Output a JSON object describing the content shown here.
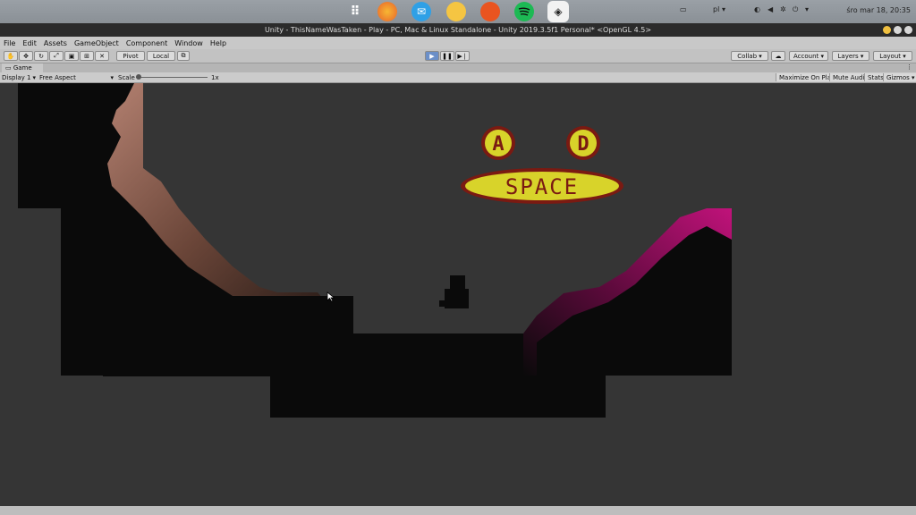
{
  "desktop": {
    "apps": [
      {
        "name": "apps-grid-icon",
        "glyph": "⋮⋮⋮",
        "color": "#8a9096"
      },
      {
        "name": "firefox-icon",
        "glyph": "",
        "color": "#e8632a"
      },
      {
        "name": "mail-icon",
        "glyph": "✉",
        "color": "#2fa0e6"
      },
      {
        "name": "files-icon",
        "glyph": "",
        "color": "#f5c542"
      },
      {
        "name": "software-icon",
        "glyph": "",
        "color": "#e95420"
      },
      {
        "name": "spotify-icon",
        "glyph": "",
        "color": "#1db954"
      },
      {
        "name": "unity-icon",
        "glyph": "◈",
        "color": "#f2f2f2"
      }
    ],
    "language": "pl",
    "clock": "śro mar 18, 20:35"
  },
  "window": {
    "title": "Unity - ThisNameWasTaken - Play - PC, Mac & Linux Standalone - Unity 2019.3.5f1 Personal* <OpenGL 4.5>"
  },
  "menu": [
    "File",
    "Edit",
    "Assets",
    "GameObject",
    "Component",
    "Window",
    "Help"
  ],
  "toolbar": {
    "pivot": "Pivot",
    "local": "Local",
    "collab": "Collab ▾",
    "account": "Account",
    "layers": "Layers",
    "layout": "Layout"
  },
  "game_panel": {
    "tab_label": "Game",
    "display": "Display 1",
    "aspect": "Free Aspect",
    "scale_label": "Scale",
    "scale_value": "1x",
    "maximize": "Maximize On Play",
    "mute": "Mute Audio",
    "stats": "Stats",
    "gizmos": "Gizmos"
  },
  "game_scene": {
    "key_a": "A",
    "key_d": "D",
    "key_space": "SPACE",
    "colors": {
      "key_fill": "#d8d32a",
      "key_border": "#7a1a12",
      "left_cliff": "#a8786a",
      "right_glow": "#c0127a"
    }
  }
}
